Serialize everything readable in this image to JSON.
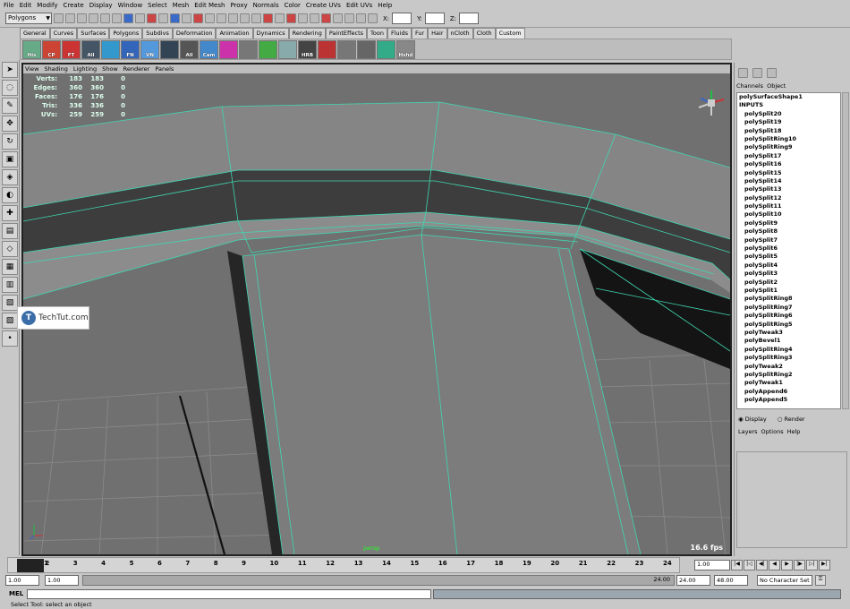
{
  "menubar": [
    "File",
    "Edit",
    "Modify",
    "Create",
    "Display",
    "Window",
    "Select",
    "Mesh",
    "Edit Mesh",
    "Proxy",
    "Normals",
    "Color",
    "Create UVs",
    "Edit UVs",
    "Help"
  ],
  "status": {
    "mode": "Polygons",
    "x_label": "X:",
    "y_label": "Y:",
    "z_label": "Z:"
  },
  "shelf_tabs": [
    "General",
    "Curves",
    "Surfaces",
    "Polygons",
    "Subdivs",
    "Deformation",
    "Animation",
    "Dynamics",
    "Rendering",
    "PaintEffects",
    "Toon",
    "Fluids",
    "Fur",
    "Hair",
    "nCloth",
    "Cloth",
    "Custom"
  ],
  "shelf_active": "Custom",
  "shelf_buttons": [
    "His",
    "CP",
    "FT",
    "All",
    "",
    "FN",
    "VN",
    "",
    "All",
    "Cam",
    "",
    "",
    "",
    "",
    "HRB",
    "",
    "",
    "",
    "",
    "Hshd"
  ],
  "viewport": {
    "menu": [
      "View",
      "Shading",
      "Lighting",
      "Show",
      "Renderer",
      "Panels"
    ],
    "hud": [
      {
        "label": "Verts:",
        "a": "183",
        "b": "183",
        "c": "0"
      },
      {
        "label": "Edges:",
        "a": "360",
        "b": "360",
        "c": "0"
      },
      {
        "label": "Faces:",
        "a": "176",
        "b": "176",
        "c": "0"
      },
      {
        "label": "Tris:",
        "a": "336",
        "b": "336",
        "c": "0"
      },
      {
        "label": "UVs:",
        "a": "259",
        "b": "259",
        "c": "0"
      }
    ],
    "camera": "persp",
    "fps": "16.6 fps"
  },
  "channels": {
    "tabs": [
      "Channels",
      "Object"
    ],
    "shape": "polySurfaceShape1",
    "inputs_label": "INPUTS",
    "items": [
      "polySplit20",
      "polySplit19",
      "polySplit18",
      "polySplitRing10",
      "polySplitRing9",
      "polySplit17",
      "polySplit16",
      "polySplit15",
      "polySplit14",
      "polySplit13",
      "polySplit12",
      "polySplit11",
      "polySplit10",
      "polySplit9",
      "polySplit8",
      "polySplit7",
      "polySplit6",
      "polySplit5",
      "polySplit4",
      "polySplit3",
      "polySplit2",
      "polySplit1",
      "polySplitRing8",
      "polySplitRing7",
      "polySplitRing6",
      "polySplitRing5",
      "polyTweak3",
      "polyBevel1",
      "polySplitRing4",
      "polySplitRing3",
      "polyTweak2",
      "polySplitRing2",
      "polyTweak1",
      "polyAppend6",
      "polyAppend5"
    ]
  },
  "layers": {
    "display": "Display",
    "render": "Render",
    "menu": [
      "Layers",
      "Options",
      "Help"
    ]
  },
  "timeline": {
    "ticks": [
      "1",
      "2",
      "3",
      "4",
      "5",
      "6",
      "7",
      "8",
      "9",
      "10",
      "11",
      "12",
      "13",
      "14",
      "15",
      "16",
      "17",
      "18",
      "19",
      "20",
      "21",
      "22",
      "23",
      "24"
    ],
    "current": "1.00"
  },
  "range": {
    "start": "1.00",
    "start2": "1.00",
    "slider_end": "24.00",
    "end": "24.00",
    "end2": "48.00",
    "char_set": "No Character Set"
  },
  "mel": {
    "label": "MEL"
  },
  "help": "Select Tool: select an object",
  "watermark": "TechTut.com"
}
